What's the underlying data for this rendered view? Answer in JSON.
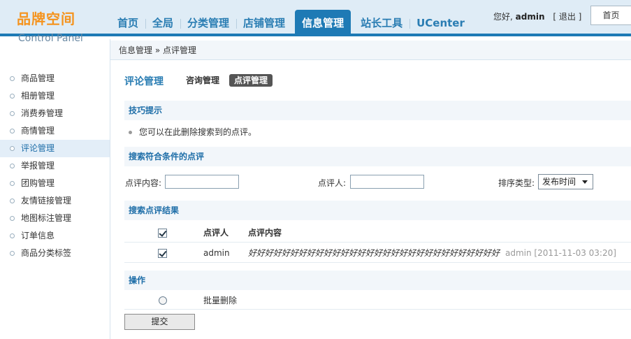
{
  "logo": {
    "brand": "品牌空间",
    "subtitle": "Control Panel"
  },
  "nav": {
    "items": [
      {
        "label": "首页"
      },
      {
        "label": "全局"
      },
      {
        "label": "分类管理"
      },
      {
        "label": "店铺管理"
      },
      {
        "label": "信息管理",
        "active": true
      },
      {
        "label": "站长工具"
      },
      {
        "label": "UCenter"
      }
    ]
  },
  "userbar": {
    "greeting": "您好,",
    "username": "admin",
    "logout": "[ 退出 ]",
    "home_button": "首页"
  },
  "sidebar": {
    "items": [
      {
        "label": "商品管理"
      },
      {
        "label": "相册管理"
      },
      {
        "label": "消费券管理"
      },
      {
        "label": "商情管理"
      },
      {
        "label": "评论管理",
        "active": true
      },
      {
        "label": "举报管理"
      },
      {
        "label": "团购管理"
      },
      {
        "label": "友情链接管理"
      },
      {
        "label": "地图标注管理"
      },
      {
        "label": "订单信息"
      },
      {
        "label": "商品分类标签"
      }
    ]
  },
  "breadcrumb": "信息管理 » 点评管理",
  "page": {
    "title": "评论管理",
    "tabs": [
      {
        "label": "咨询管理"
      },
      {
        "label": "点评管理",
        "active": true
      }
    ]
  },
  "tips": {
    "heading": "技巧提示",
    "text": "您可以在此删除搜索到的点评。"
  },
  "search": {
    "heading": "搜索符合条件的点评",
    "content_label": "点评内容:",
    "content_value": "",
    "reviewer_label": "点评人:",
    "reviewer_value": "",
    "sort_label": "排序类型:",
    "sort_selected": "发布时间"
  },
  "results": {
    "heading": "搜索点评结果",
    "columns": {
      "reviewer": "点评人",
      "content": "点评内容"
    },
    "rows": [
      {
        "checked": true,
        "reviewer": "admin",
        "content": "好好好好好好好好好好好好好好好好好好好好好好好好好好好好好好",
        "meta": "admin [2011-11-03 03:20]"
      }
    ]
  },
  "operations": {
    "heading": "操作",
    "batch_delete": "批量删除",
    "submit": "提交"
  },
  "colors": {
    "accent": "#1e7ab5",
    "logo": "#f5931d",
    "section_bg": "#f2f6fa"
  }
}
